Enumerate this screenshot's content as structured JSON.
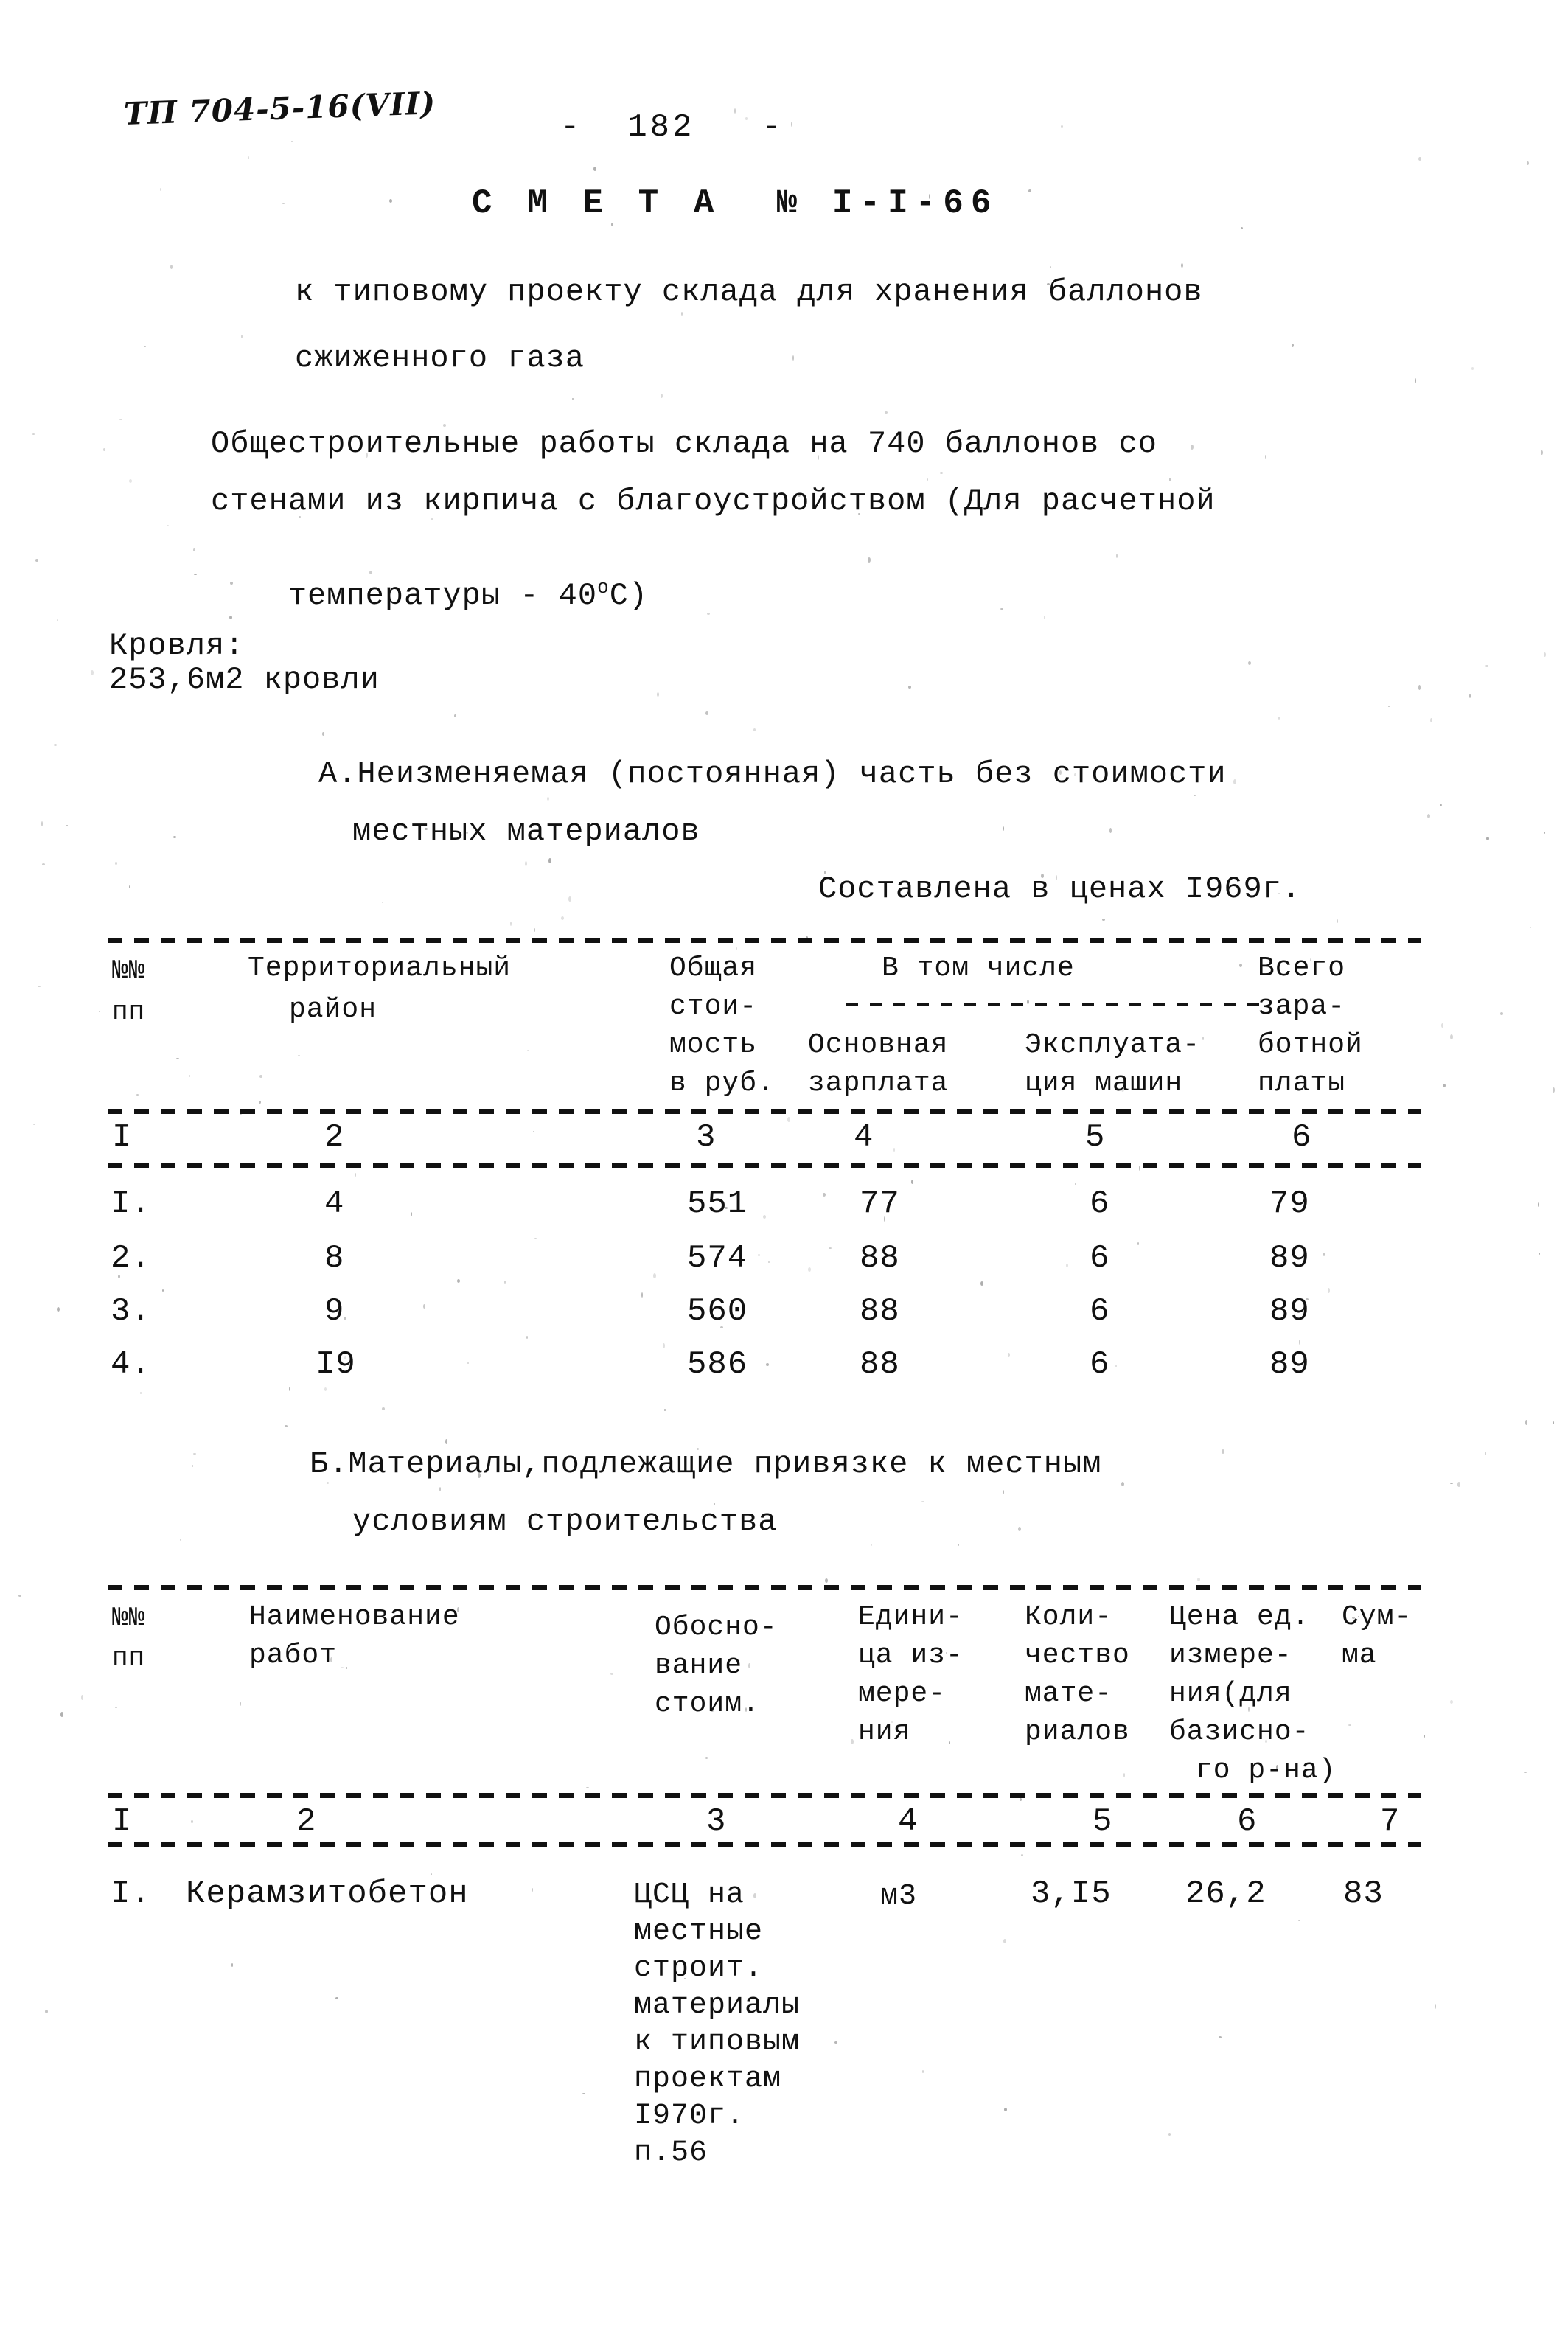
{
  "page": {
    "handwritten_code": "ТП 704-5-16(VII)",
    "page_number": "-  182   -"
  },
  "header": {
    "title": "С М Е Т А  № I-I-66",
    "subtitle_line1": "к типовому проекту склада для хранения баллонов",
    "subtitle_line2": "сжиженного газа",
    "description_line1": "Общестроительные работы склада на 740 баллонов со",
    "description_line2": "стенами из кирпича с благоустройством (Для расчетной",
    "description_line3_pre": "температуры - 40",
    "description_line3_sup": "o",
    "description_line3_post": "С)"
  },
  "roof": {
    "label": "Кровля:",
    "value": "253,6м2 кровли"
  },
  "section_a": {
    "heading_line1": "А.Неизменяемая (постоянная) часть без стоимости",
    "heading_line2": "местных материалов",
    "prices_note": "Составлена в ценах I969г."
  },
  "table_a": {
    "headers": {
      "num_l1": "№№",
      "num_l2": "пп",
      "district_l1": "Территориальный",
      "district_l2": "район",
      "total_l1": "Общая",
      "total_l2": "стои-",
      "total_l3": "мость",
      "total_l4": "в руб.",
      "group_label": "В том числе",
      "wages_l1": "Основная",
      "wages_l2": "зарплата",
      "machines_l1": "Эксплуата-",
      "machines_l2": "ция машин",
      "all_l1": "Всего",
      "all_l2": "зара-",
      "all_l3": "ботной",
      "all_l4": "платы"
    },
    "column_numbers": [
      "I",
      "2",
      "3",
      "4",
      "5",
      "6"
    ],
    "rows": [
      {
        "no": "I.",
        "district": "4",
        "total": "551",
        "wages": "77",
        "machines": "6",
        "all_wages": "79"
      },
      {
        "no": "2.",
        "district": "8",
        "total": "574",
        "wages": "88",
        "machines": "6",
        "all_wages": "89"
      },
      {
        "no": "3.",
        "district": "9",
        "total": "560",
        "wages": "88",
        "machines": "6",
        "all_wages": "89"
      },
      {
        "no": "4.",
        "district": "I9",
        "total": "586",
        "wages": "88",
        "machines": "6",
        "all_wages": "89"
      }
    ]
  },
  "section_b": {
    "heading_line1": "Б.Материалы,подлежащие привязке к местным",
    "heading_line2": "условиям строительства"
  },
  "table_b": {
    "headers": {
      "num_l1": "№№",
      "num_l2": "пп",
      "name_l1": "Наименование",
      "name_l2": "работ",
      "basis_l1": "Обосно-",
      "basis_l2": "вание",
      "basis_l3": "стоим.",
      "unit_l1": "Едини-",
      "unit_l2": "ца из-",
      "unit_l3": "мере-",
      "unit_l4": "ния",
      "qty_l1": "Коли-",
      "qty_l2": "чество",
      "qty_l3": "мате-",
      "qty_l4": "риалов",
      "price_l1": "Цена ед.",
      "price_l2": "измере-",
      "price_l3": "ния(для",
      "price_l4": "базисно-",
      "price_l5": "го р-на)",
      "sum_l1": "Сум-",
      "sum_l2": "ма"
    },
    "column_numbers": [
      "I",
      "2",
      "3",
      "4",
      "5",
      "6",
      "7"
    ],
    "rows": [
      {
        "no": "I.",
        "name": "Керамзитобетон",
        "basis_lines": [
          "ЦСЦ на",
          "местные",
          "строит.",
          "материалы",
          "к типовым",
          "проектам",
          "I970г.",
          "п.56"
        ],
        "unit": "м3",
        "qty": "3,I5",
        "price": "26,2",
        "sum": "83"
      }
    ]
  }
}
